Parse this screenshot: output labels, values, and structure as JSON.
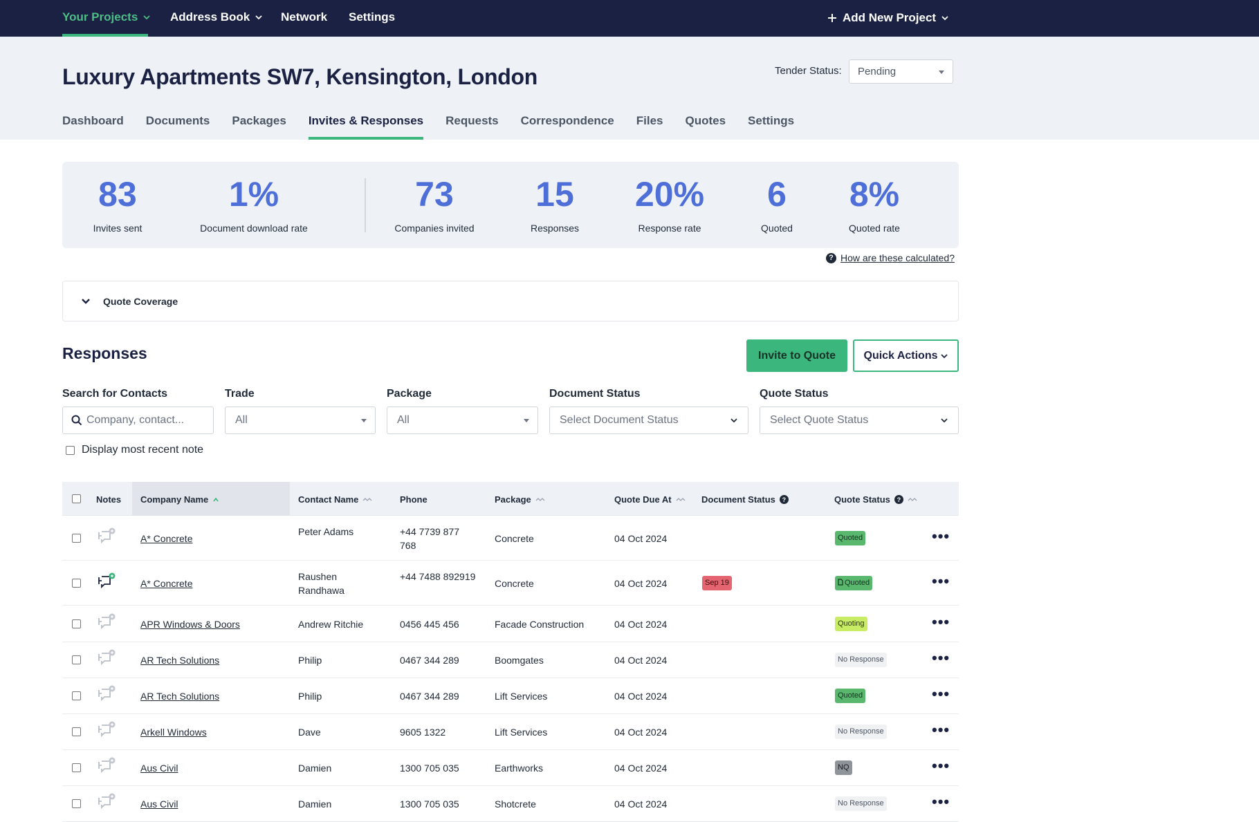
{
  "topnav": {
    "items": [
      {
        "label": "Your Projects",
        "active": true,
        "has_dropdown": true
      },
      {
        "label": "Address Book",
        "active": false,
        "has_dropdown": true
      },
      {
        "label": "Network",
        "active": false,
        "has_dropdown": false
      },
      {
        "label": "Settings",
        "active": false,
        "has_dropdown": false
      }
    ],
    "add_project_label": "Add New Project"
  },
  "header": {
    "project_title": "Luxury Apartments SW7, Kensington, London",
    "tender_status_label": "Tender Status:",
    "tender_status_value": "Pending",
    "tabs": [
      {
        "label": "Dashboard",
        "active": false
      },
      {
        "label": "Documents",
        "active": false
      },
      {
        "label": "Packages",
        "active": false
      },
      {
        "label": "Invites & Responses",
        "active": true
      },
      {
        "label": "Requests",
        "active": false
      },
      {
        "label": "Correspondence",
        "active": false
      },
      {
        "label": "Files",
        "active": false
      },
      {
        "label": "Quotes",
        "active": false
      },
      {
        "label": "Settings",
        "active": false
      }
    ]
  },
  "stats": [
    {
      "value": "83",
      "label": "Invites sent"
    },
    {
      "value": "1%",
      "label": "Document download rate"
    },
    {
      "value": "73",
      "label": "Companies invited"
    },
    {
      "value": "15",
      "label": "Responses"
    },
    {
      "value": "20%",
      "label": "Response rate"
    },
    {
      "value": "6",
      "label": "Quoted"
    },
    {
      "value": "8%",
      "label": "Quoted rate"
    }
  ],
  "calc_link": "How are these calculated?",
  "coverage_label": "Quote Coverage",
  "responses": {
    "title": "Responses",
    "invite_button": "Invite to Quote",
    "quick_actions_button": "Quick Actions"
  },
  "filters": {
    "search_label": "Search for Contacts",
    "search_placeholder": "Company, contact...",
    "trade_label": "Trade",
    "trade_value": "All",
    "package_label": "Package",
    "package_value": "All",
    "doc_status_label": "Document Status",
    "doc_status_value": "Select Document Status",
    "quote_status_label": "Quote Status",
    "quote_status_value": "Select Quote Status",
    "recent_note_label": "Display most recent note"
  },
  "table": {
    "headers": {
      "notes": "Notes",
      "company": "Company Name",
      "contact": "Contact Name",
      "phone": "Phone",
      "package": "Package",
      "due": "Quote Due At",
      "doc_status": "Document Status",
      "quote_status": "Quote Status"
    },
    "rows": [
      {
        "company": "A* Concrete",
        "contact": "Peter Adams",
        "phone": "+44 7739 877 768",
        "package": "Concrete",
        "due": "04 Oct 2024",
        "doc_status": "",
        "quote_status": "Quoted",
        "quote_kind": "quoted",
        "has_note": false
      },
      {
        "company": "A* Concrete",
        "contact": "Raushen Randhawa",
        "phone": "+44 7488 892919",
        "package": "Concrete",
        "due": "04 Oct 2024",
        "doc_status": "Sep 19",
        "quote_status": "Quoted",
        "quote_kind": "quoted-doc",
        "has_note": true
      },
      {
        "company": "APR Windows & Doors",
        "contact": "Andrew Ritchie",
        "phone": "0456 445 456",
        "package": "Facade Construction",
        "due": "04 Oct 2024",
        "doc_status": "",
        "quote_status": "Quoting",
        "quote_kind": "quoting",
        "has_note": false
      },
      {
        "company": "AR Tech Solutions",
        "contact": "Philip",
        "phone": "0467 344 289",
        "package": "Boomgates",
        "due": "04 Oct 2024",
        "doc_status": "",
        "quote_status": "No Response",
        "quote_kind": "noresp",
        "has_note": false
      },
      {
        "company": "AR Tech Solutions",
        "contact": "Philip",
        "phone": "0467 344 289",
        "package": "Lift Services",
        "due": "04 Oct 2024",
        "doc_status": "",
        "quote_status": "Quoted",
        "quote_kind": "quoted",
        "has_note": false
      },
      {
        "company": "Arkell Windows",
        "contact": "Dave",
        "phone": "9605 1322",
        "package": "Lift Services",
        "due": "04 Oct 2024",
        "doc_status": "",
        "quote_status": "No Response",
        "quote_kind": "noresp",
        "has_note": false
      },
      {
        "company": "Aus Civil",
        "contact": "Damien",
        "phone": "1300 705 035",
        "package": "Earthworks",
        "due": "04 Oct 2024",
        "doc_status": "",
        "quote_status": "NQ",
        "quote_kind": "nq",
        "has_note": false
      },
      {
        "company": "Aus Civil",
        "contact": "Damien",
        "phone": "1300 705 035",
        "package": "Shotcrete",
        "due": "04 Oct 2024",
        "doc_status": "",
        "quote_status": "No Response",
        "quote_kind": "noresp",
        "has_note": false
      }
    ]
  },
  "colors": {
    "nav_bg": "#1b2142",
    "accent_green": "#3bb77e",
    "stat_blue": "#4e6fd8",
    "header_bg": "#eef2f7"
  }
}
